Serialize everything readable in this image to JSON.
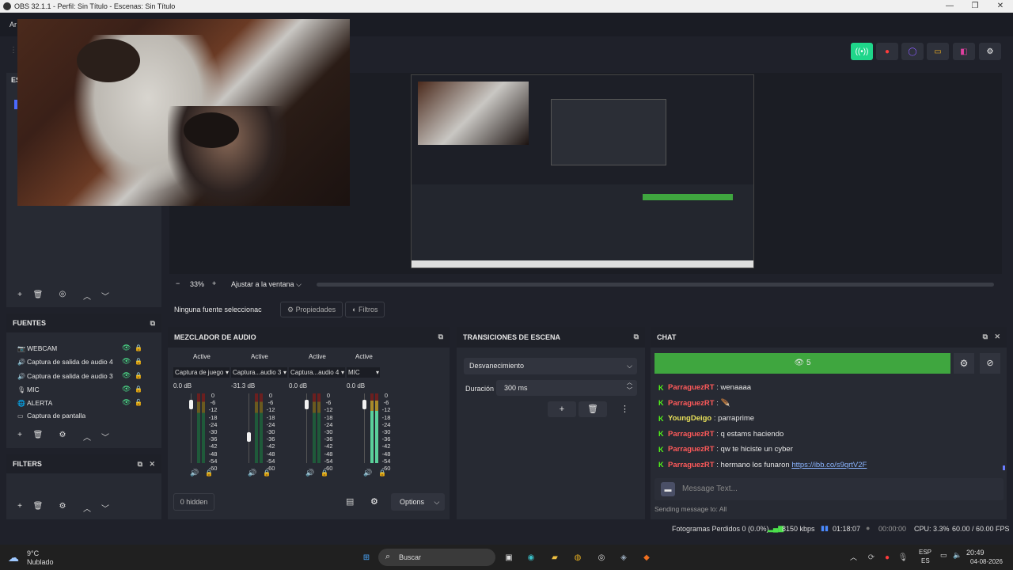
{
  "window": {
    "title": "OBS 32.1.1 - Perfil: Sin Título - Escenas: Sin Título",
    "minimize": "—",
    "maximize": "❐",
    "close": "✕"
  },
  "menubar": {
    "first_item": "Ar"
  },
  "toolbar": {
    "buttons": [
      {
        "icon": "broadcast-icon",
        "glyph": "((•))",
        "color": "#1fd68a"
      },
      {
        "icon": "record-icon",
        "glyph": "●",
        "color": "#ff3b3b"
      },
      {
        "icon": "replay-icon",
        "glyph": "◯",
        "color": "#8a5cff"
      },
      {
        "icon": "virtual-camera-icon",
        "glyph": "▭",
        "color": "#f0b020"
      },
      {
        "icon": "studio-mode-icon",
        "glyph": "◧",
        "color": "#e040a0"
      },
      {
        "icon": "settings-icon",
        "glyph": "⚙",
        "color": "#ffffff"
      }
    ]
  },
  "scenes_panel": {
    "header_partial": "ES"
  },
  "zoom": {
    "minus": "−",
    "value": "33%",
    "plus": "+",
    "fit_label": "Ajustar a la ventana"
  },
  "source_bar": {
    "status": "Ninguna fuente seleccionac",
    "properties": "Propiedades",
    "filters": "Filtros"
  },
  "sources": {
    "title": "FUENTES",
    "items": [
      {
        "icon": "camera-icon",
        "glyph": "📷",
        "label": "WEBCAM",
        "locked": true
      },
      {
        "icon": "speaker-icon",
        "glyph": "🔊",
        "label": "Captura de salida de audio 4",
        "locked": true
      },
      {
        "icon": "speaker-icon",
        "glyph": "🔊",
        "label": "Captura de salida de audio 3",
        "locked": true
      },
      {
        "icon": "mic-icon",
        "glyph": "🎙",
        "label": "MIC",
        "locked": true
      },
      {
        "icon": "globe-icon",
        "glyph": "🌐",
        "label": "ALERTA",
        "locked": false
      },
      {
        "icon": "monitor-icon",
        "glyph": "▭",
        "label": "Captura de pantalla",
        "locked": false
      }
    ]
  },
  "filters_panel": {
    "title": "FILTERS"
  },
  "mixer": {
    "title": "MEZCLADOR DE AUDIO",
    "channels": [
      {
        "status": "Active",
        "name": "Captura de juego",
        "db": "0.0 dB",
        "fader": 0.9,
        "active_meter": false
      },
      {
        "status": "Active",
        "name": "Captura...audio 3",
        "db": "-31.3 dB",
        "fader": 0.35,
        "active_meter": false
      },
      {
        "status": "Active",
        "name": "Captura...audio 4",
        "db": "0.0 dB",
        "fader": 0.9,
        "active_meter": false
      },
      {
        "status": "Active",
        "name": "MIC",
        "db": "0.0 dB",
        "fader": 0.9,
        "active_meter": true
      }
    ],
    "scale": [
      "0",
      "-6",
      "-12",
      "-18",
      "-24",
      "-30",
      "-36",
      "-42",
      "-48",
      "-54",
      "-60"
    ],
    "hidden_label": "0 hidden",
    "options_label": "Options"
  },
  "transitions": {
    "title": "TRANSICIONES DE ESCENA",
    "selected": "Desvanecimiento",
    "duration_label": "Duración",
    "duration_value": "300 ms"
  },
  "chat": {
    "title": "CHAT",
    "viewers": "5",
    "messages": [
      {
        "user": "ParraguezRT",
        "color": "red",
        "text": "wenaaaa",
        "link": ""
      },
      {
        "user": "ParraguezRT",
        "color": "red",
        "text": "🪶",
        "link": ""
      },
      {
        "user": "YoungDeigo",
        "color": "yellow",
        "text": "parraprime",
        "link": ""
      },
      {
        "user": "ParraguezRT",
        "color": "red",
        "text": "q estams haciendo",
        "link": ""
      },
      {
        "user": "ParraguezRT",
        "color": "red",
        "text": "qw te hiciste un cyber",
        "link": ""
      },
      {
        "user": "ParraguezRT",
        "color": "red",
        "text": "hermano los funaron",
        "link": "https://ibb.co/s9qrtV2F"
      }
    ],
    "input_placeholder": "Message Text...",
    "sending_to": "Sending message to: All"
  },
  "statusbar": {
    "dropped": "Fotogramas Perdidos 0 (0.0%)",
    "bitrate": "8150 kbps",
    "stream_time": "01:18:07",
    "record_time": "00:00:00",
    "cpu": "CPU: 3.3%",
    "fps": "60.00 / 60.00 FPS"
  },
  "taskbar": {
    "weather_temp": "9°C",
    "weather_desc": "Nublado",
    "search_placeholder": "Buscar",
    "lang_top": "ESP",
    "lang_bottom": "ES",
    "time": "20:49",
    "date": "04-08-2026"
  }
}
